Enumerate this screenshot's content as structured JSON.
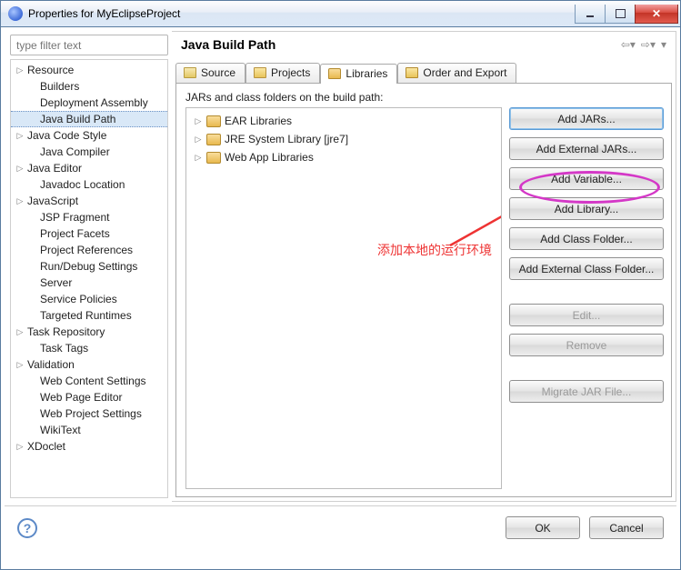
{
  "window": {
    "title": "Properties for MyEclipseProject"
  },
  "filter": {
    "placeholder": "type filter text"
  },
  "nav": {
    "items": [
      {
        "label": "Resource",
        "level": 0,
        "exp": true
      },
      {
        "label": "Builders",
        "level": 1,
        "exp": false
      },
      {
        "label": "Deployment Assembly",
        "level": 1,
        "exp": false
      },
      {
        "label": "Java Build Path",
        "level": 1,
        "exp": false,
        "selected": true
      },
      {
        "label": "Java Code Style",
        "level": 0,
        "exp": true
      },
      {
        "label": "Java Compiler",
        "level": 1,
        "exp": false
      },
      {
        "label": "Java Editor",
        "level": 0,
        "exp": true
      },
      {
        "label": "Javadoc Location",
        "level": 1,
        "exp": false
      },
      {
        "label": "JavaScript",
        "level": 0,
        "exp": true
      },
      {
        "label": "JSP Fragment",
        "level": 1,
        "exp": false
      },
      {
        "label": "Project Facets",
        "level": 1,
        "exp": false
      },
      {
        "label": "Project References",
        "level": 1,
        "exp": false
      },
      {
        "label": "Run/Debug Settings",
        "level": 1,
        "exp": false
      },
      {
        "label": "Server",
        "level": 1,
        "exp": false
      },
      {
        "label": "Service Policies",
        "level": 1,
        "exp": false
      },
      {
        "label": "Targeted Runtimes",
        "level": 1,
        "exp": false
      },
      {
        "label": "Task Repository",
        "level": 0,
        "exp": true
      },
      {
        "label": "Task Tags",
        "level": 1,
        "exp": false
      },
      {
        "label": "Validation",
        "level": 0,
        "exp": true
      },
      {
        "label": "Web Content Settings",
        "level": 1,
        "exp": false
      },
      {
        "label": "Web Page Editor",
        "level": 1,
        "exp": false
      },
      {
        "label": "Web Project Settings",
        "level": 1,
        "exp": false
      },
      {
        "label": "WikiText",
        "level": 1,
        "exp": false
      },
      {
        "label": "XDoclet",
        "level": 0,
        "exp": true
      }
    ]
  },
  "page": {
    "heading": "Java Build Path",
    "tabs": {
      "source": "Source",
      "projects": "Projects",
      "libraries": "Libraries",
      "order": "Order and Export"
    },
    "caption": "JARs and class folders on the build path:",
    "tree": {
      "n0": "EAR Libraries",
      "n1": "JRE System Library [jre7]",
      "n2": "Web App Libraries"
    },
    "buttons": {
      "addJars": "Add JARs...",
      "addExtJars": "Add External JARs...",
      "addVariable": "Add Variable...",
      "addLibrary": "Add Library...",
      "addClassFolder": "Add Class Folder...",
      "addExtClassFolder": "Add External Class Folder...",
      "edit": "Edit...",
      "remove": "Remove",
      "migrate": "Migrate JAR File..."
    }
  },
  "annotation": {
    "text": "添加本地的运行环境"
  },
  "footer": {
    "ok": "OK",
    "cancel": "Cancel"
  }
}
